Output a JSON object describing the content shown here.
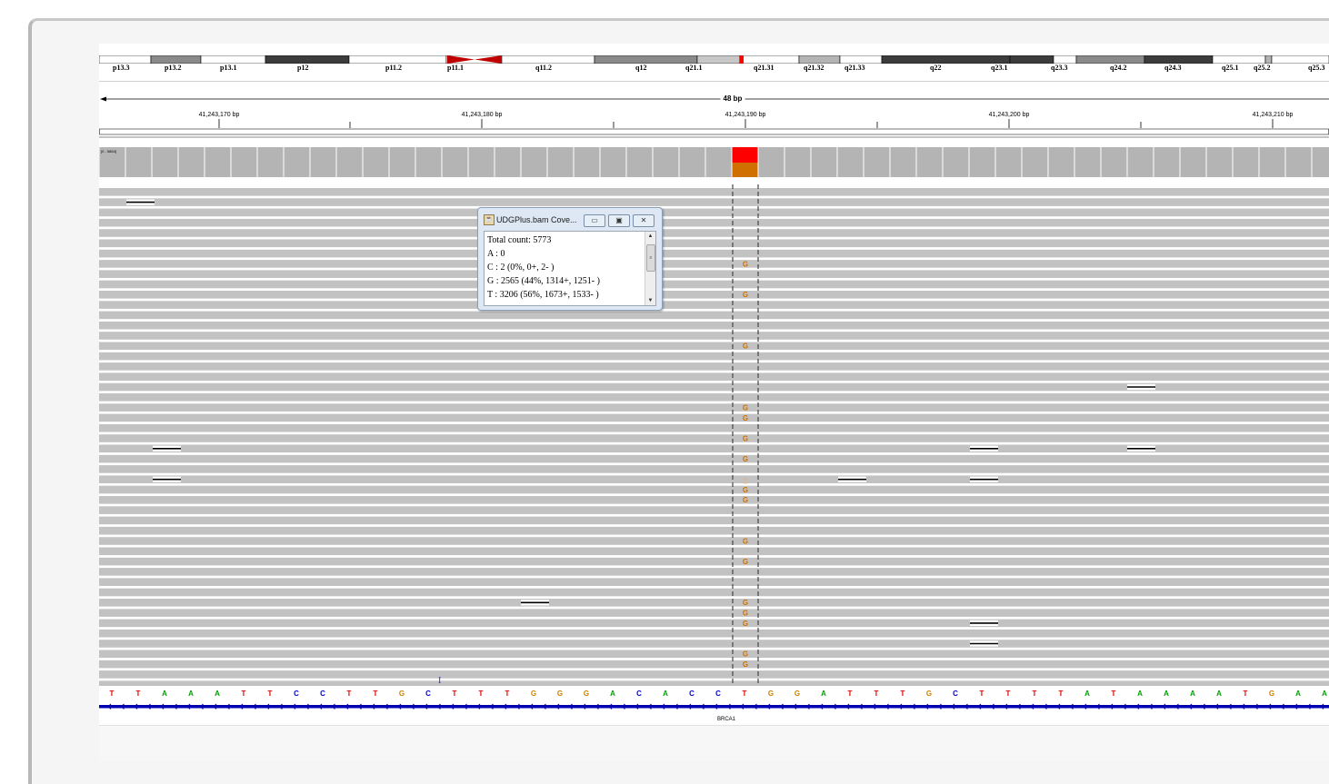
{
  "ideogram": {
    "bands": [
      {
        "label": "p13.3",
        "color": "#ffffff"
      },
      {
        "label": "p13.2",
        "color": "#8a8a8a"
      },
      {
        "label": "p13.1",
        "color": "#ffffff"
      },
      {
        "label": "p12",
        "color": "#3c3c3c"
      },
      {
        "label": "p11.2",
        "color": "#ffffff"
      },
      {
        "label": "p11.1",
        "color": "#ffffff"
      },
      {
        "label": "q11.2",
        "color": "#ffffff"
      },
      {
        "label": "q12",
        "color": "#8a8a8a"
      },
      {
        "label": "q21.1",
        "color": "#c8c8c8"
      },
      {
        "label": "q21.31",
        "color": "#ffffff"
      },
      {
        "label": "q21.32",
        "color": "#b4b4b4"
      },
      {
        "label": "q21.33",
        "color": "#ffffff"
      },
      {
        "label": "q22",
        "color": "#3c3c3c"
      },
      {
        "label": "q23.1",
        "color": "#3c3c3c"
      },
      {
        "label": "q23.3",
        "color": "#ffffff"
      },
      {
        "label": "q24.2",
        "color": "#8a8a8a"
      },
      {
        "label": "q24.3",
        "color": "#3c3c3c"
      },
      {
        "label": "q25.1",
        "color": "#ffffff"
      },
      {
        "label": "q25.2",
        "color": "#b4b4b4"
      },
      {
        "label": "q25.3",
        "color": "#ffffff"
      }
    ],
    "centromere_color": "#c00000",
    "current_region_color": "#ff0000"
  },
  "ruler": {
    "span_label": "48 bp",
    "coordinates": [
      {
        "label": "41,243,170 bp"
      },
      {
        "label": "41,243,180 bp"
      },
      {
        "label": "41,243,190 bp"
      },
      {
        "label": "41,243,200 bp"
      },
      {
        "label": "41,243,210 bp"
      }
    ]
  },
  "coverage": {
    "range_label": "[0 - 5864]",
    "bar_color": "#b4b4b4",
    "highlight_fraction_top": 0.56,
    "highlight_top_color": "#ff0000",
    "highlight_bottom_color": "#d07000"
  },
  "reads": {
    "read_color": "#c2c2c2",
    "row_count": 50,
    "mismatch_base": "G",
    "mismatch_color": "#d07000"
  },
  "reference_sequence": "TTAAATTCCTTGCTTTGGGACACCTGGATTTGCTTTTATAAAATGAA",
  "base_colors": {
    "A": "#00a000",
    "C": "#0000d0",
    "G": "#d08000",
    "T": "#e00000"
  },
  "cursor_glyph": "I",
  "gene": {
    "name": "BRCA1",
    "color": "#0000b0"
  },
  "popup": {
    "title": "UDGPlus.bam Cove...",
    "lines": [
      "Total count: 5773",
      "A : 0",
      "C : 2 (0%, 0+, 2- )",
      "G : 2565 (44%, 1314+, 1251- )",
      "T : 3206 (56%, 1673+, 1533- )"
    ],
    "minimize_glyph": "▭",
    "maximize_glyph": "▣",
    "close_glyph": "✕",
    "scroll_up_glyph": "▲",
    "scroll_down_glyph": "▼",
    "scroll_grip_glyph": "≡",
    "app_icon_glyph": "☕"
  }
}
